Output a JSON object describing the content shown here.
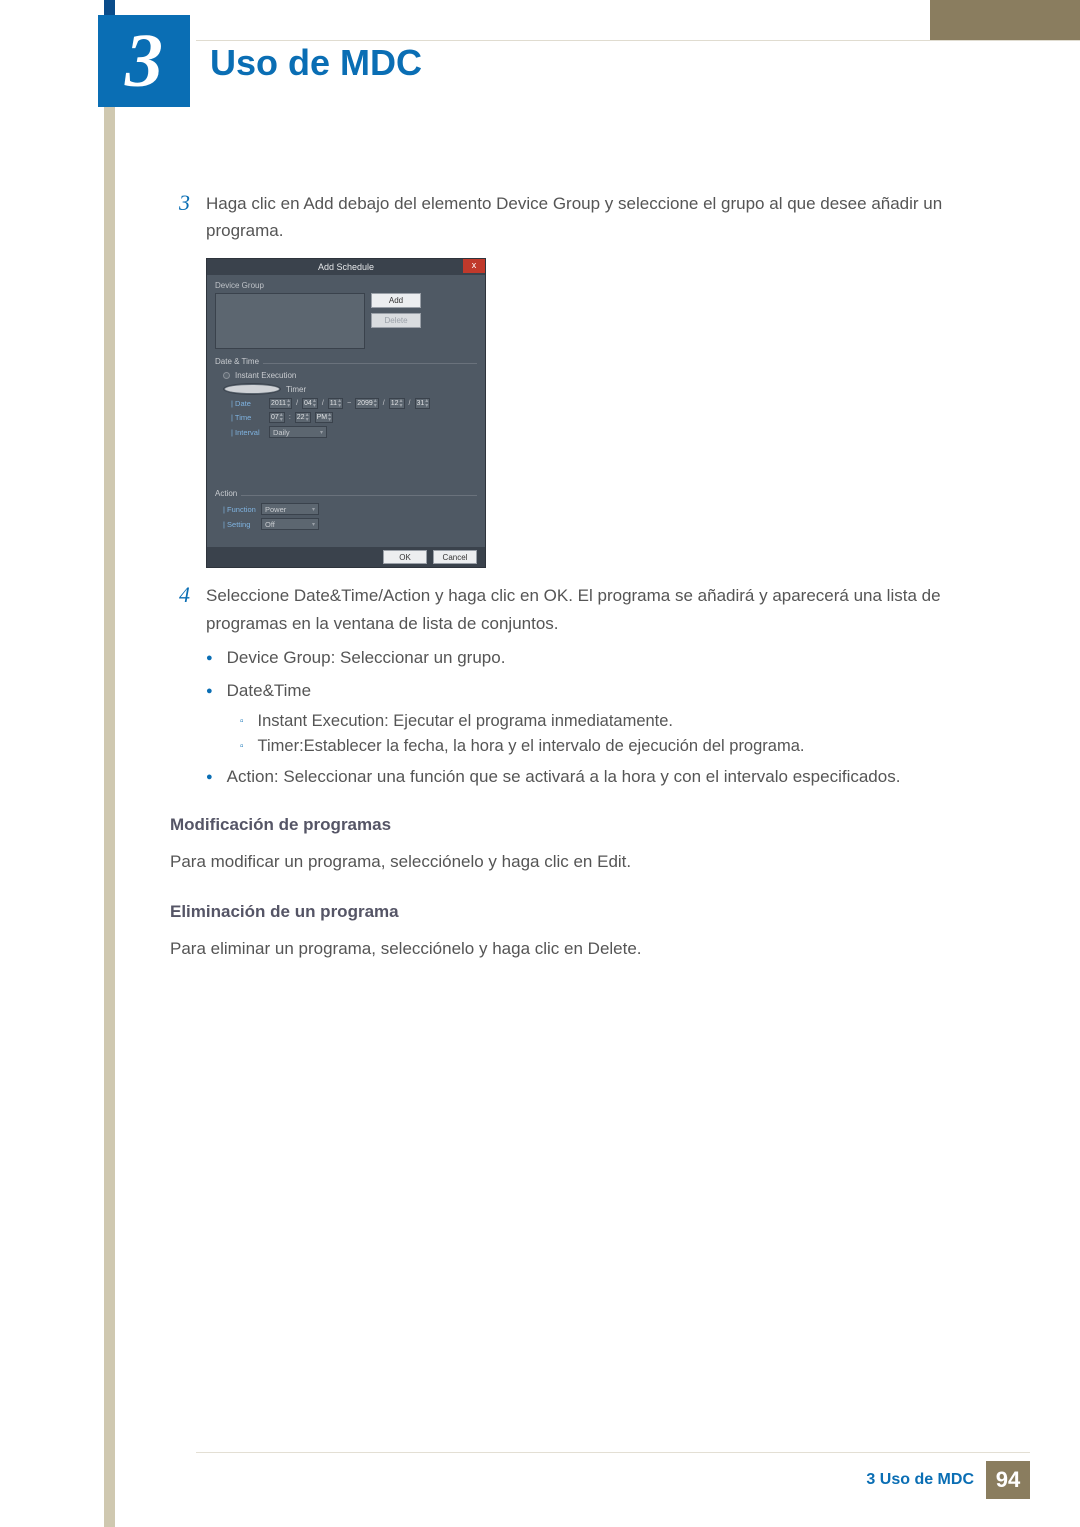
{
  "chapter": {
    "number": "3",
    "title": "Uso de MDC"
  },
  "steps": {
    "s3": {
      "num": "3",
      "text": "Haga clic en Add debajo del elemento Device Group y seleccione el grupo al que desee añadir un programa."
    },
    "s4": {
      "num": "4",
      "text": "Seleccione Date&Time/Action y haga clic en OK. El programa se añadirá y aparecerá una lista de programas en la ventana de lista de conjuntos."
    }
  },
  "dialog": {
    "title": "Add Schedule",
    "close": "x",
    "device_group_label": "Device Group",
    "add_btn": "Add",
    "delete_btn": "Delete",
    "datetime_label": "Date & Time",
    "instant_exec": "Instant Execution",
    "timer": "Timer",
    "date_label": "| Date",
    "time_label": "| Time",
    "interval_label": "| Interval",
    "date": {
      "y1": "2011",
      "m1": "04",
      "d1": "11",
      "tilde": "~",
      "y2": "2099",
      "m2": "12",
      "d2": "31",
      "slash": "/"
    },
    "time": {
      "h": "07",
      "m": "22",
      "ap": "PM"
    },
    "interval_val": "Daily",
    "action_label": "Action",
    "function_label": "| Function",
    "function_val": "Power",
    "setting_label": "| Setting",
    "setting_val": "Off",
    "ok": "OK",
    "cancel": "Cancel",
    "spin_arrows": "▴▾"
  },
  "bullets": {
    "b1": "Device Group: Seleccionar un grupo.",
    "b2": "Date&Time",
    "b2a": "Instant Execution: Ejecutar el programa inmediatamente.",
    "b2b": "Timer:Establecer la fecha, la hora y el intervalo de ejecución del programa.",
    "b3": "Action: Seleccionar una función que se activará a la hora y con el intervalo especificados."
  },
  "sections": {
    "mod_head": "Modificación de programas",
    "mod_body": "Para modificar un programa, selecciónelo y haga clic en Edit.",
    "del_head": "Eliminación de un programa",
    "del_body": "Para eliminar un programa, selecciónelo y haga clic en Delete."
  },
  "footer": {
    "text": "3 Uso de MDC",
    "page": "94"
  }
}
